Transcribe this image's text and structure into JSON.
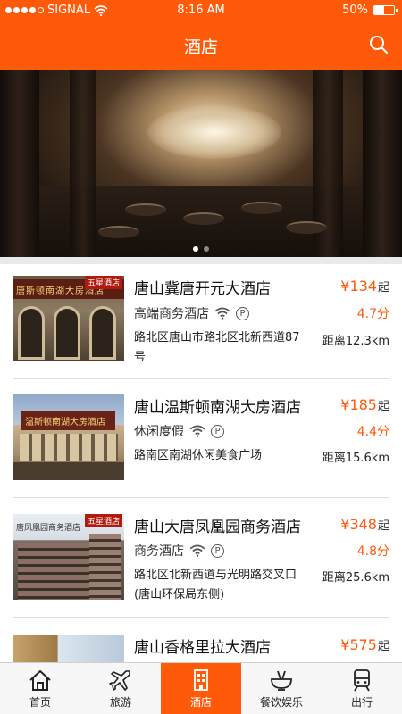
{
  "status_bar": {
    "carrier": "SIGNAL",
    "time": "8:16 AM",
    "battery": "50%",
    "battery_level": 0.5
  },
  "header": {
    "title": "酒店",
    "search_icon": "search-icon"
  },
  "banner": {
    "page_count": 2,
    "active_page": 0
  },
  "hotels": [
    {
      "name": "唐山冀唐开元大酒店",
      "price": "¥134",
      "price_unit": "起",
      "category": "高端商务酒店",
      "score": "4.7分",
      "address": "路北区唐山市路北区北新西道87号",
      "distance": "距离12.3km",
      "amenities": [
        "wifi-icon",
        "parking-icon"
      ],
      "sign": "唐斯顿南湖大房酒店",
      "badge": "五星酒店"
    },
    {
      "name": "唐山温斯顿南湖大房酒店",
      "price": "¥185",
      "price_unit": "起",
      "category": "休闲度假",
      "score": "4.4分",
      "address": "路南区南湖休闲美食广场",
      "distance": "距离15.6km",
      "amenities": [
        "wifi-icon",
        "parking-icon"
      ],
      "sign": "温斯顿南湖大房酒店"
    },
    {
      "name": "唐山大唐凤凰园商务酒店",
      "price": "¥348",
      "price_unit": "起",
      "category": "商务酒店",
      "score": "4.8分",
      "address": " 路北区北新西道与光明路交叉口(唐山环保局东侧)",
      "distance": "距离25.6km",
      "amenities": [
        "wifi-icon",
        "parking-icon"
      ],
      "sign": "唐凤凰园商务酒店",
      "badge": "五星酒店"
    },
    {
      "name": "唐山香格里拉大酒店",
      "price": "¥575",
      "price_unit": "起"
    }
  ],
  "tabbar": [
    {
      "label": "首页",
      "icon": "home-icon"
    },
    {
      "label": "旅游",
      "icon": "plane-icon"
    },
    {
      "label": "酒店",
      "icon": "hotel-icon",
      "active": true
    },
    {
      "label": "餐饮娱乐",
      "icon": "dining-icon"
    },
    {
      "label": "出行",
      "icon": "train-icon"
    }
  ],
  "colors": {
    "accent": "#ff5a0a",
    "divider": "#dedede",
    "tabbar_bg": "#f7f7f7"
  }
}
